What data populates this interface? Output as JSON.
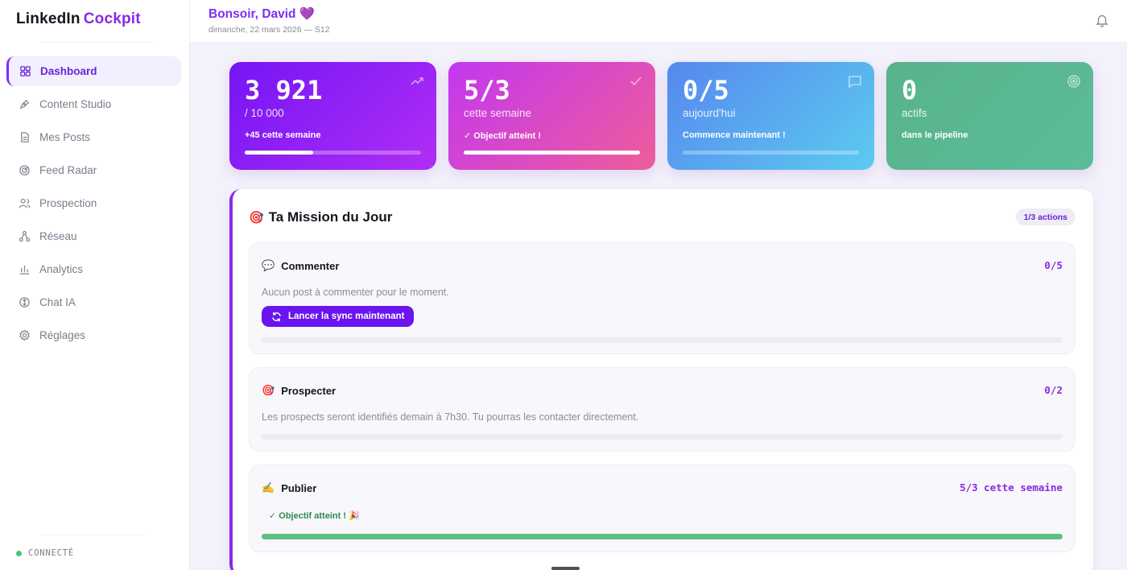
{
  "app": {
    "brand_part1": "LinkedIn",
    "brand_part2": "Cockpit",
    "accent": "#7b2ff7"
  },
  "sidebar": {
    "items": [
      {
        "label": "Dashboard",
        "icon": "grid-icon",
        "active": true
      },
      {
        "label": "Content Studio",
        "icon": "pen-tool-icon"
      },
      {
        "label": "Mes Posts",
        "icon": "document-icon"
      },
      {
        "label": "Feed Radar",
        "icon": "radar-icon"
      },
      {
        "label": "Prospection",
        "icon": "users-icon"
      },
      {
        "label": "Réseau",
        "icon": "network-icon"
      },
      {
        "label": "Analytics",
        "icon": "bar-chart-icon"
      },
      {
        "label": "Chat IA",
        "icon": "ai-chat-icon"
      },
      {
        "label": "Réglages",
        "icon": "settings-icon"
      }
    ],
    "status": "CONNECTÉ"
  },
  "header": {
    "greeting": "Bonsoir, David",
    "greeting_emoji": "💜",
    "date": "dimanche, 22 mars 2026 — S12"
  },
  "stats": [
    {
      "value": "3 921",
      "sub": "/ 10 000",
      "note": "+45 cette semaine",
      "progress": 0.39,
      "icon": "trending-up-icon"
    },
    {
      "value": "5/3",
      "sub": "cette semaine",
      "note": "✓ Objectif atteint !",
      "progress": 1.0,
      "icon": "check-icon"
    },
    {
      "value": "0/5",
      "sub": "aujourd'hui",
      "note": "Commence maintenant !",
      "progress": 0.0,
      "icon": "message-icon"
    },
    {
      "value": "0",
      "sub": "actifs",
      "note": "dans le pipeline",
      "icon": "target-icon"
    }
  ],
  "mission": {
    "emoji": "🎯",
    "title": "Ta Mission du Jour",
    "badge": "1/3 actions",
    "tasks": [
      {
        "emoji": "💬",
        "title": "Commenter",
        "count": "0/5",
        "desc": "Aucun post à commenter pour le moment.",
        "button": "Lancer la sync maintenant",
        "progress": 0.0
      },
      {
        "emoji": "🎯",
        "title": "Prospecter",
        "count": "0/2",
        "desc": "Les prospects seront identifiés demain à 7h30. Tu pourras les contacter directement.",
        "progress": 0.0
      },
      {
        "emoji": "✍️",
        "title": "Publier",
        "count": "5/3 cette semaine",
        "note": "✓ Objectif atteint ! 🎉",
        "progress": 1.0
      }
    ]
  }
}
